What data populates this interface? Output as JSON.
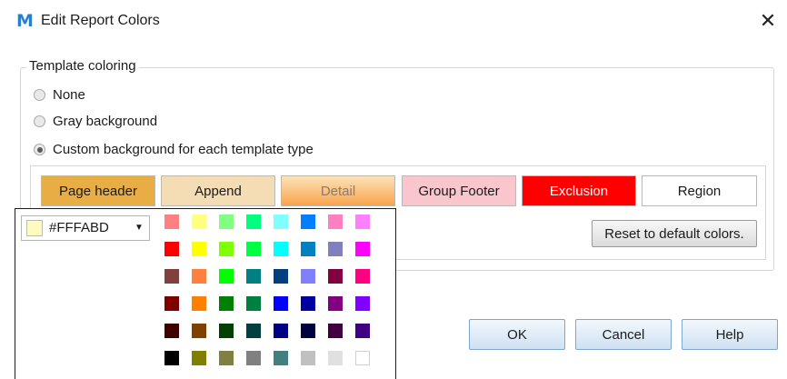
{
  "window": {
    "title": "Edit Report Colors",
    "app_icon_glyph": "M",
    "app_icon": "app-logo-icon",
    "close_icon": "close-icon",
    "close_glyph": "✕"
  },
  "template_coloring": {
    "legend": "Template coloring",
    "options": [
      {
        "label": "None",
        "checked": false
      },
      {
        "label": "Gray background",
        "checked": false
      },
      {
        "label": "Custom background for each template type",
        "checked": true
      }
    ]
  },
  "template_types": [
    {
      "label": "Page header",
      "bg": "#E8AD45",
      "fg": "#1b1b1b"
    },
    {
      "label": "Append",
      "bg": "#F4DDB4",
      "fg": "#1b1b1b"
    },
    {
      "label": "Detail",
      "bg": "#F8B46A",
      "fg": "#8a7b6a"
    },
    {
      "label": "Group Footer",
      "bg": "#F9C6CE",
      "fg": "#1b1b1b"
    },
    {
      "label": "Exclusion",
      "bg": "#FF0000",
      "fg": "#ffffff"
    },
    {
      "label": "Region",
      "bg": "#FFFFFF",
      "fg": "#1b1b1b"
    }
  ],
  "reset_label": "Reset to default colors.",
  "buttons": {
    "ok": "OK",
    "cancel": "Cancel",
    "help": "Help"
  },
  "color_picker": {
    "selected_value": "#FFFABD",
    "dropdown_icon": "caret-down-icon",
    "dropdown_glyph": "▼",
    "palette": [
      [
        "#FF8080",
        "#FFFF80",
        "#80FF80",
        "#00FF80",
        "#80FFFF",
        "#0080FF",
        "#FF80C0",
        "#FF80FF"
      ],
      [
        "#FF0000",
        "#FFFF00",
        "#80FF00",
        "#00FF40",
        "#00FFFF",
        "#0080C0",
        "#8080C0",
        "#FF00FF"
      ],
      [
        "#804040",
        "#FF8040",
        "#00FF00",
        "#008080",
        "#004080",
        "#8080FF",
        "#800040",
        "#FF0080"
      ],
      [
        "#800000",
        "#FF8000",
        "#008000",
        "#008040",
        "#0000FF",
        "#0000A0",
        "#800080",
        "#8000FF"
      ],
      [
        "#400000",
        "#804000",
        "#004000",
        "#004040",
        "#000080",
        "#000040",
        "#400040",
        "#400080"
      ],
      [
        "#000000",
        "#808000",
        "#808040",
        "#808080",
        "#408080",
        "#C0C0C0",
        "#E0E0E0",
        "#FFFFFF"
      ]
    ]
  }
}
